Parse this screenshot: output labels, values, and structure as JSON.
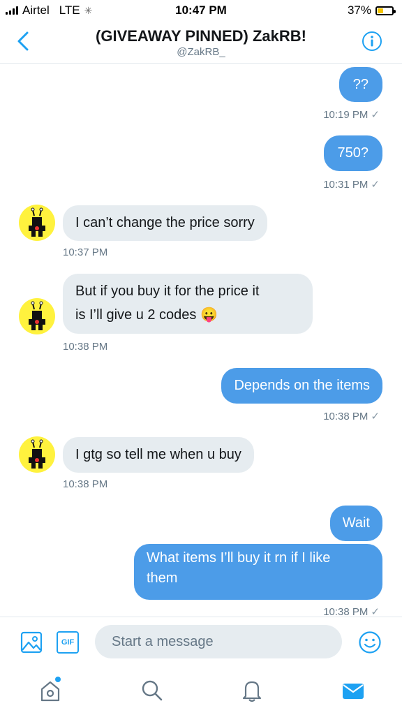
{
  "status_bar": {
    "carrier": "Airtel",
    "network": "LTE",
    "time": "10:47 PM",
    "battery": "37%",
    "battery_level": 0.37
  },
  "header": {
    "title": "(GIVEAWAY PINNED) ZakRB!",
    "handle": "@ZakRB_"
  },
  "messages": [
    {
      "from": "me",
      "lines": [
        "??"
      ],
      "time": "10:19 PM"
    },
    {
      "from": "me",
      "lines": [
        "750?"
      ],
      "time": "10:31 PM"
    },
    {
      "from": "them",
      "lines": [
        "I can’t change the price sorry"
      ],
      "time": "10:37 PM"
    },
    {
      "from": "them",
      "lines": [
        "But if you buy it for the price it",
        "is I’ll give u 2 codes 😛"
      ],
      "time": "10:38 PM"
    },
    {
      "from": "me",
      "lines": [
        "Depends on the items"
      ],
      "time": "10:38 PM"
    },
    {
      "from": "them",
      "lines": [
        "I gtg so tell me when u buy"
      ],
      "time": "10:38 PM"
    },
    {
      "from": "me",
      "lines": [
        "Wait"
      ],
      "time": ""
    },
    {
      "from": "me",
      "lines": [
        "What items I’ll buy it rn if I like",
        "them"
      ],
      "time": "10:38 PM"
    }
  ],
  "composer": {
    "placeholder": "Start a message",
    "gif_label": "GIF"
  },
  "tabs": [
    {
      "name": "home",
      "icon": "home-icon",
      "has_notification_dot": true
    },
    {
      "name": "search",
      "icon": "search-icon"
    },
    {
      "name": "notifications",
      "icon": "bell-icon"
    },
    {
      "name": "messages",
      "icon": "mail-icon",
      "active": true
    }
  ],
  "colors": {
    "accent": "#1da1f2",
    "outgoing_bubble": "#4c9ce8",
    "incoming_bubble": "#e6ecf0",
    "avatar_bg": "#fff23e"
  }
}
